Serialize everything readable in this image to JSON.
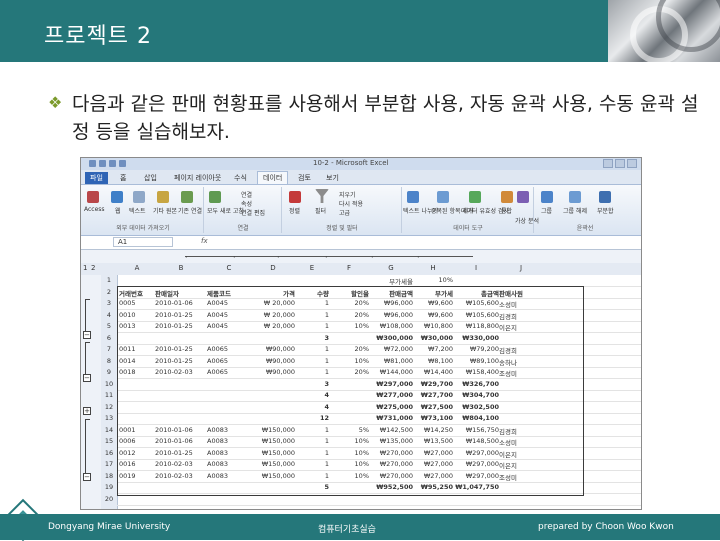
{
  "header": {
    "title": "프로젝트 2"
  },
  "bullet": {
    "text": "다음과 같은 판매 현황표를 사용해서 부분합 사용, 자동 윤곽 사용, 수동 윤곽 설정 등을 실습해보자."
  },
  "screenshot": {
    "window_title": "10-2 - Microsoft Excel",
    "tabs": [
      "파일",
      "홈",
      "삽입",
      "페이지 레이아웃",
      "수식",
      "데이터",
      "검토",
      "보기"
    ],
    "active_tab": "데이터",
    "ribbon_groups": [
      "외부 데이터 가져오기",
      "연결",
      "정렬 및 필터",
      "데이터 도구",
      "윤곽선"
    ],
    "ribbon_buttons": [
      "Access",
      "웹",
      "텍스트",
      "기타 원본",
      "기존 연결",
      "모두 새로 고침",
      "연결",
      "속성",
      "연결 편집",
      "정렬",
      "필터",
      "지우기",
      "다시 적용",
      "고급",
      "텍스트 나누기",
      "중복된 항목 제거",
      "데이터 유효성 검사",
      "통합",
      "가상 분석",
      "그룹",
      "그룹 해제",
      "부분합"
    ],
    "name_box": "A1",
    "fx": "fx",
    "outline_levels": [
      "1",
      "2"
    ],
    "columns": [
      "A",
      "B",
      "C",
      "D",
      "E",
      "F",
      "G",
      "H",
      "I",
      "J"
    ],
    "row_numbers": [
      "1",
      "2",
      "3",
      "4",
      "5",
      "6",
      "7",
      "8",
      "9",
      "10",
      "11",
      "12",
      "13",
      "14",
      "15",
      "16",
      "17",
      "18",
      "19",
      "20"
    ],
    "rows": [
      [
        "",
        "",
        "",
        "",
        "",
        "",
        "부가세율",
        "10%",
        "",
        ""
      ],
      [
        "거래번호",
        "판매일자",
        "제품코드",
        "가격",
        "수량",
        "할인율",
        "판매금액",
        "부가세",
        "총금액",
        "판매사원"
      ],
      [
        "0005",
        "2010-01-06",
        "A0045",
        "₩ 20,000",
        "1",
        "20%",
        "₩96,000",
        "₩9,600",
        "₩105,600",
        "소성미"
      ],
      [
        "0010",
        "2010-01-25",
        "A0045",
        "₩ 20,000",
        "1",
        "20%",
        "₩96,000",
        "₩9,600",
        "₩105,600",
        "김경희"
      ],
      [
        "0013",
        "2010-01-25",
        "A0045",
        "₩ 20,000",
        "1",
        "10%",
        "₩108,000",
        "₩10,800",
        "₩118,800",
        "이은지"
      ],
      [
        "",
        "",
        "",
        "",
        "3",
        "",
        "₩300,000",
        "₩30,000",
        "₩330,000",
        ""
      ],
      [
        "0011",
        "2010-01-25",
        "A0065",
        "₩90,000",
        "1",
        "20%",
        "₩72,000",
        "₩7,200",
        "₩79,200",
        "김경희"
      ],
      [
        "0014",
        "2010-01-25",
        "A0065",
        "₩90,000",
        "1",
        "10%",
        "₩81,000",
        "₩8,100",
        "₩89,100",
        "송하나"
      ],
      [
        "0018",
        "2010-02-03",
        "A0065",
        "₩90,000",
        "1",
        "20%",
        "₩144,000",
        "₩14,400",
        "₩158,400",
        "조성미"
      ],
      [
        "",
        "",
        "",
        "",
        "3",
        "",
        "₩297,000",
        "₩29,700",
        "₩326,700",
        ""
      ],
      [
        "",
        "",
        "",
        "",
        "4",
        "",
        "₩277,000",
        "₩27,700",
        "₩304,700",
        ""
      ],
      [
        "",
        "",
        "",
        "",
        "4",
        "",
        "₩275,000",
        "₩27,500",
        "₩302,500",
        ""
      ],
      [
        "",
        "",
        "",
        "",
        "12",
        "",
        "₩731,000",
        "₩73,100",
        "₩804,100",
        ""
      ],
      [
        "0001",
        "2010-01-06",
        "A0083",
        "₩150,000",
        "1",
        "5%",
        "₩142,500",
        "₩14,250",
        "₩156,750",
        "김경희"
      ],
      [
        "0006",
        "2010-01-06",
        "A0083",
        "₩150,000",
        "1",
        "10%",
        "₩135,000",
        "₩13,500",
        "₩148,500",
        "소성미"
      ],
      [
        "0012",
        "2010-01-25",
        "A0083",
        "₩150,000",
        "1",
        "10%",
        "₩270,000",
        "₩27,000",
        "₩297,000",
        "이은지"
      ],
      [
        "0016",
        "2010-02-03",
        "A0083",
        "₩150,000",
        "1",
        "10%",
        "₩270,000",
        "₩27,000",
        "₩297,000",
        "이은지"
      ],
      [
        "0019",
        "2010-02-03",
        "A0083",
        "₩150,000",
        "1",
        "10%",
        "₩270,000",
        "₩27,000",
        "₩297,000",
        "조성미"
      ],
      [
        "",
        "",
        "",
        "",
        "5",
        "",
        "₩952,500",
        "₩95,250",
        "₩1,047,750",
        ""
      ],
      [
        "",
        "",
        "",
        "",
        "",
        "",
        "",
        "",
        "",
        ""
      ]
    ]
  },
  "footer": {
    "left": "Dongyang Mirae University",
    "center": "컴퓨터기초실습",
    "right": "prepared by Choon Woo Kwon"
  },
  "colors": {
    "header_bg": "#25777a",
    "bullet": "#7b9a2b"
  }
}
